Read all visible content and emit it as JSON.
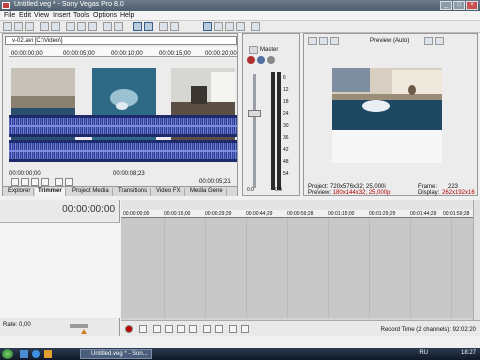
{
  "window": {
    "title": "Untitled.veg * - Sony Vegas Pro 8.0",
    "min": "_",
    "max": "□",
    "close": "×"
  },
  "menu": [
    "File",
    "Edit",
    "View",
    "Insert",
    "Tools",
    "Options",
    "Help"
  ],
  "trimmer": {
    "path": "v-02.avi    [C:\\Video\\]",
    "ruler_start": "00:00:00;00",
    "ruler_marks": [
      "00:00:05;00",
      "00:00:10;00",
      "00:00:15;00",
      "00:00:20;00"
    ],
    "in_time": "00:00:00;00",
    "duration": "00:00:08;23",
    "out_time": "00:00:05;21"
  },
  "tabs": [
    "Explorer",
    "Trimmer",
    "Project Media",
    "Transitions",
    "Video FX",
    "Media Gene"
  ],
  "mixer": {
    "title": "Master",
    "scale": [
      "6",
      "12",
      "18",
      "24",
      "30",
      "36",
      "42",
      "48",
      "54"
    ],
    "vol_left": "0.0",
    "vol_right": "0.0"
  },
  "preview": {
    "mode": "Preview (Auto)",
    "project_label": "Project:",
    "project_value": "720x576x32; 25,000i",
    "preview_label": "Preview:",
    "preview_value": "180x144x32; 25,000p",
    "frame_label": "Frame:",
    "frame_value": "223",
    "display_label": "Display:",
    "display_value": "262x192x16"
  },
  "timeline": {
    "timecode": "00:00:00:00",
    "rate": "Rate: 0,00",
    "ruler": [
      "00:00:00;00",
      "00:00:15;00",
      "00:00:29;29",
      "00:00:44;29",
      "00:00:59;28",
      "00:01:15;00",
      "00:01:29;29",
      "00:01:44;29",
      "00:01:59;28"
    ],
    "record_time": "Record Time (2 channels): 92:02:20"
  },
  "taskbar": {
    "task_label": "Untitled.veg * - Son...",
    "lang": "RU",
    "clock": "18:27"
  },
  "colors": {
    "accent": "#3a5e8a",
    "waveform": "#1e2a6c",
    "record": "#c00000"
  }
}
